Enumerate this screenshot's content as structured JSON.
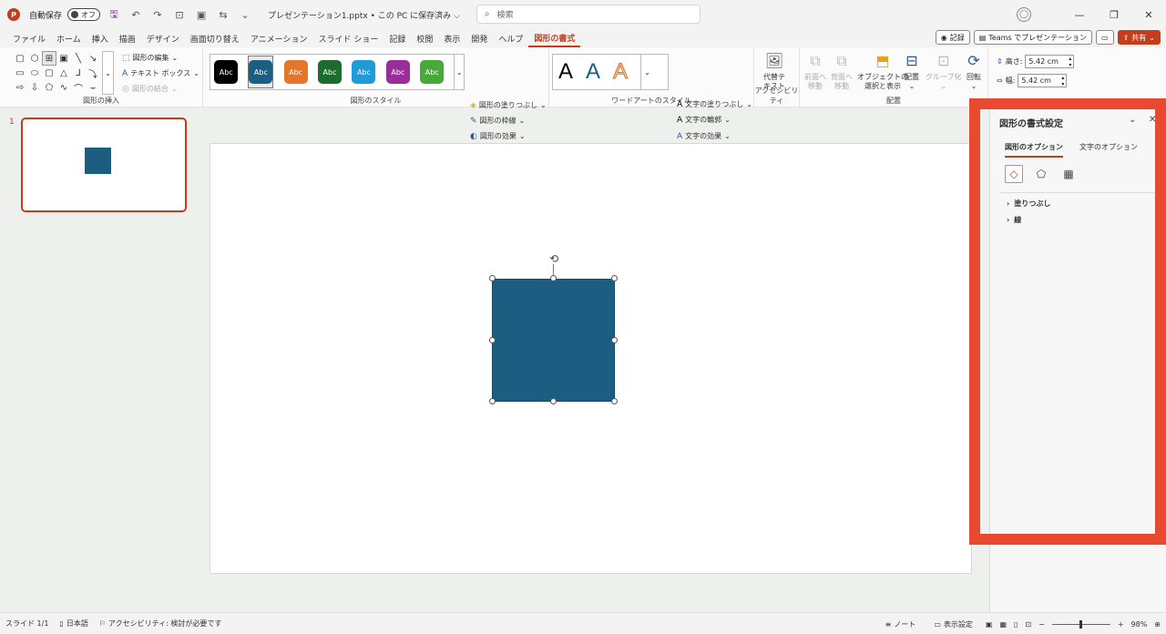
{
  "titlebar": {
    "autosave_label": "自動保存",
    "autosave_state": "オフ",
    "file_title": "プレゼンテーション1.pptx • この PC に保存済み ⌵",
    "search_placeholder": "検索"
  },
  "menu": {
    "tabs": [
      "ファイル",
      "ホーム",
      "挿入",
      "描画",
      "デザイン",
      "画面切り替え",
      "アニメーション",
      "スライド ショー",
      "記録",
      "校閲",
      "表示",
      "開発",
      "ヘルプ",
      "図形の書式"
    ],
    "active_tab": "図形の書式",
    "record_btn": "記録",
    "teams_btn": "Teams でプレゼンテーション",
    "share_btn": "共有"
  },
  "ribbon": {
    "insert_shapes": {
      "label": "図形の挿入",
      "edit_shape": "図形の編集",
      "text_box": "テキスト ボックス",
      "merge_shapes": "図形の結合"
    },
    "shape_styles": {
      "label": "図形のスタイル",
      "gallery": [
        {
          "text": "Abc",
          "color": "#000000"
        },
        {
          "text": "Abc",
          "color": "#1c5e81"
        },
        {
          "text": "Abc",
          "color": "#e3762a"
        },
        {
          "text": "Abc",
          "color": "#1e6b2e"
        },
        {
          "text": "Abc",
          "color": "#1f9bd7"
        },
        {
          "text": "Abc",
          "color": "#9b2d9b"
        },
        {
          "text": "Abc",
          "color": "#4aa83a"
        }
      ],
      "fill": "図形の塗りつぶし",
      "outline": "図形の枠線",
      "effects": "図形の効果"
    },
    "wordart": {
      "label": "ワードアートのスタイル",
      "text_fill": "文字の塗りつぶし",
      "text_outline": "文字の輪郭",
      "text_effects": "文字の効果"
    },
    "accessibility": {
      "label": "アクセシビリティ",
      "alt_text_line1": "代替テ",
      "alt_text_line2": "キスト"
    },
    "arrange": {
      "label": "配置",
      "bring_forward_1": "前面へ",
      "bring_forward_2": "移動",
      "send_backward_1": "背面へ",
      "send_backward_2": "移動",
      "selection_pane_1": "オブジェクトの",
      "selection_pane_2": "選択と表示",
      "align": "配置",
      "group": "グループ化",
      "rotate": "回転"
    },
    "size": {
      "height_label": "高さ:",
      "height_value": "5.42 cm",
      "width_label": "幅:",
      "width_value": "5.42 cm"
    }
  },
  "thumbnails": {
    "slide_number": "1"
  },
  "format_pane": {
    "title": "図形の書式設定",
    "tab_shape": "図形のオプション",
    "tab_text": "文字のオプション",
    "section_fill": "塗りつぶし",
    "section_line": "線"
  },
  "statusbar": {
    "slide_info": "スライド 1/1",
    "language": "日本語",
    "accessibility": "アクセシビリティ: 検討が必要です",
    "notes": "ノート",
    "display_settings": "表示設定",
    "zoom": "98%"
  },
  "colors": {
    "accent": "#c43e1c",
    "shape_fill": "#1c5e81",
    "highlight": "#e8492f"
  }
}
